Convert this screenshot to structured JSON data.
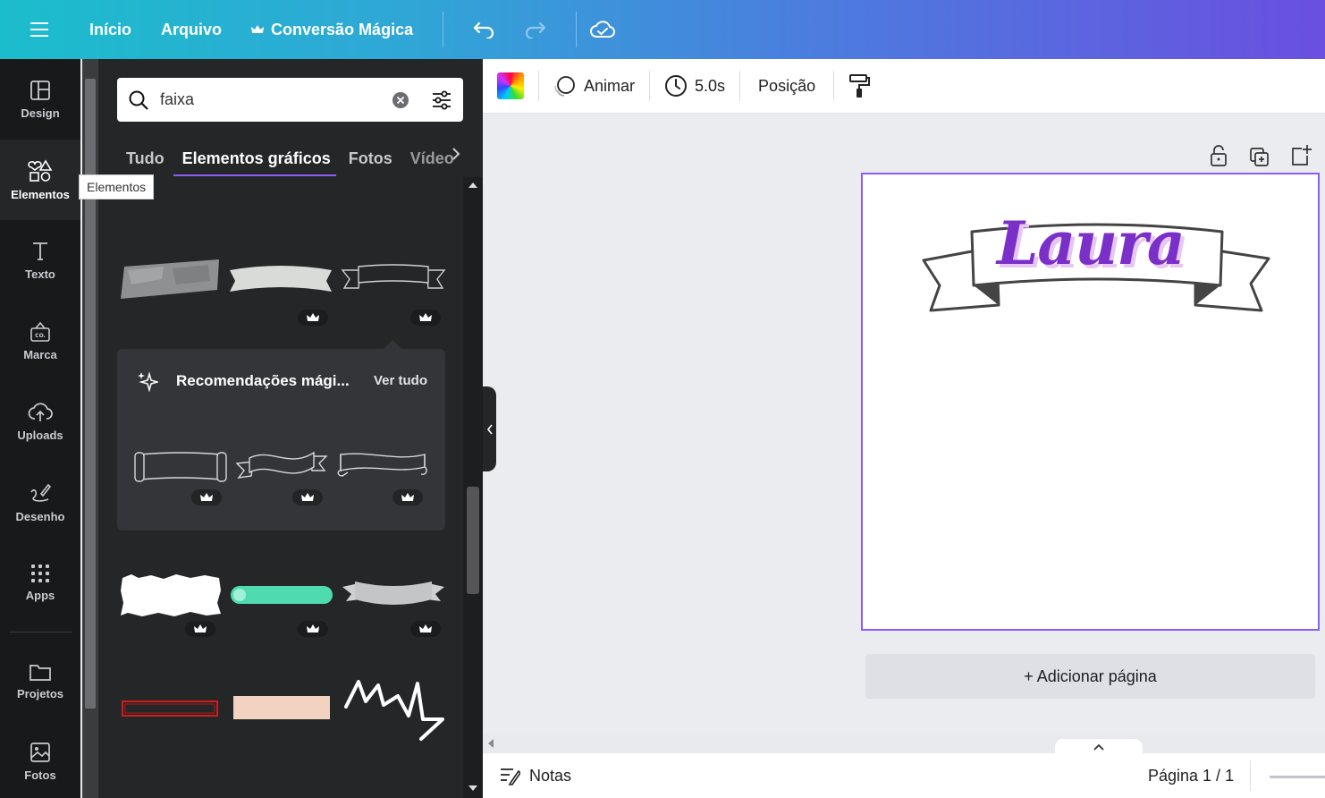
{
  "topbar": {
    "home": "Início",
    "file": "Arquivo",
    "magic_switch": "Conversão Mágica"
  },
  "rail": {
    "items": [
      {
        "label": "Design",
        "icon": "layout-icon"
      },
      {
        "label": "Elementos",
        "icon": "shapes-icon"
      },
      {
        "label": "Texto",
        "icon": "text-icon"
      },
      {
        "label": "Marca",
        "icon": "brand-icon"
      },
      {
        "label": "Uploads",
        "icon": "cloud-upload-icon"
      },
      {
        "label": "Desenho",
        "icon": "draw-icon"
      },
      {
        "label": "Apps",
        "icon": "apps-grid-icon"
      },
      {
        "label": "Projetos",
        "icon": "folder-icon"
      },
      {
        "label": "Fotos",
        "icon": "image-icon"
      }
    ],
    "tooltip": "Elementos"
  },
  "panel": {
    "search_value": "faixa",
    "tabs": [
      "Tudo",
      "Elementos gráficos",
      "Fotos",
      "Vídeos"
    ],
    "active_tab": "Elementos gráficos",
    "magic_title": "Recomendações mági...",
    "see_all": "Ver tudo"
  },
  "toolbar": {
    "animate": "Animar",
    "duration": "5.0s",
    "position": "Posição"
  },
  "canvas": {
    "design_text": "Laura",
    "add_page": "+ Adicionar página"
  },
  "footer": {
    "notes": "Notas",
    "page_info": "Página 1 / 1"
  },
  "colors": {
    "accent": "#8b5cf6",
    "design_text_color": "#7b2fc9",
    "design_text_shadow": "#e7c6f2"
  }
}
